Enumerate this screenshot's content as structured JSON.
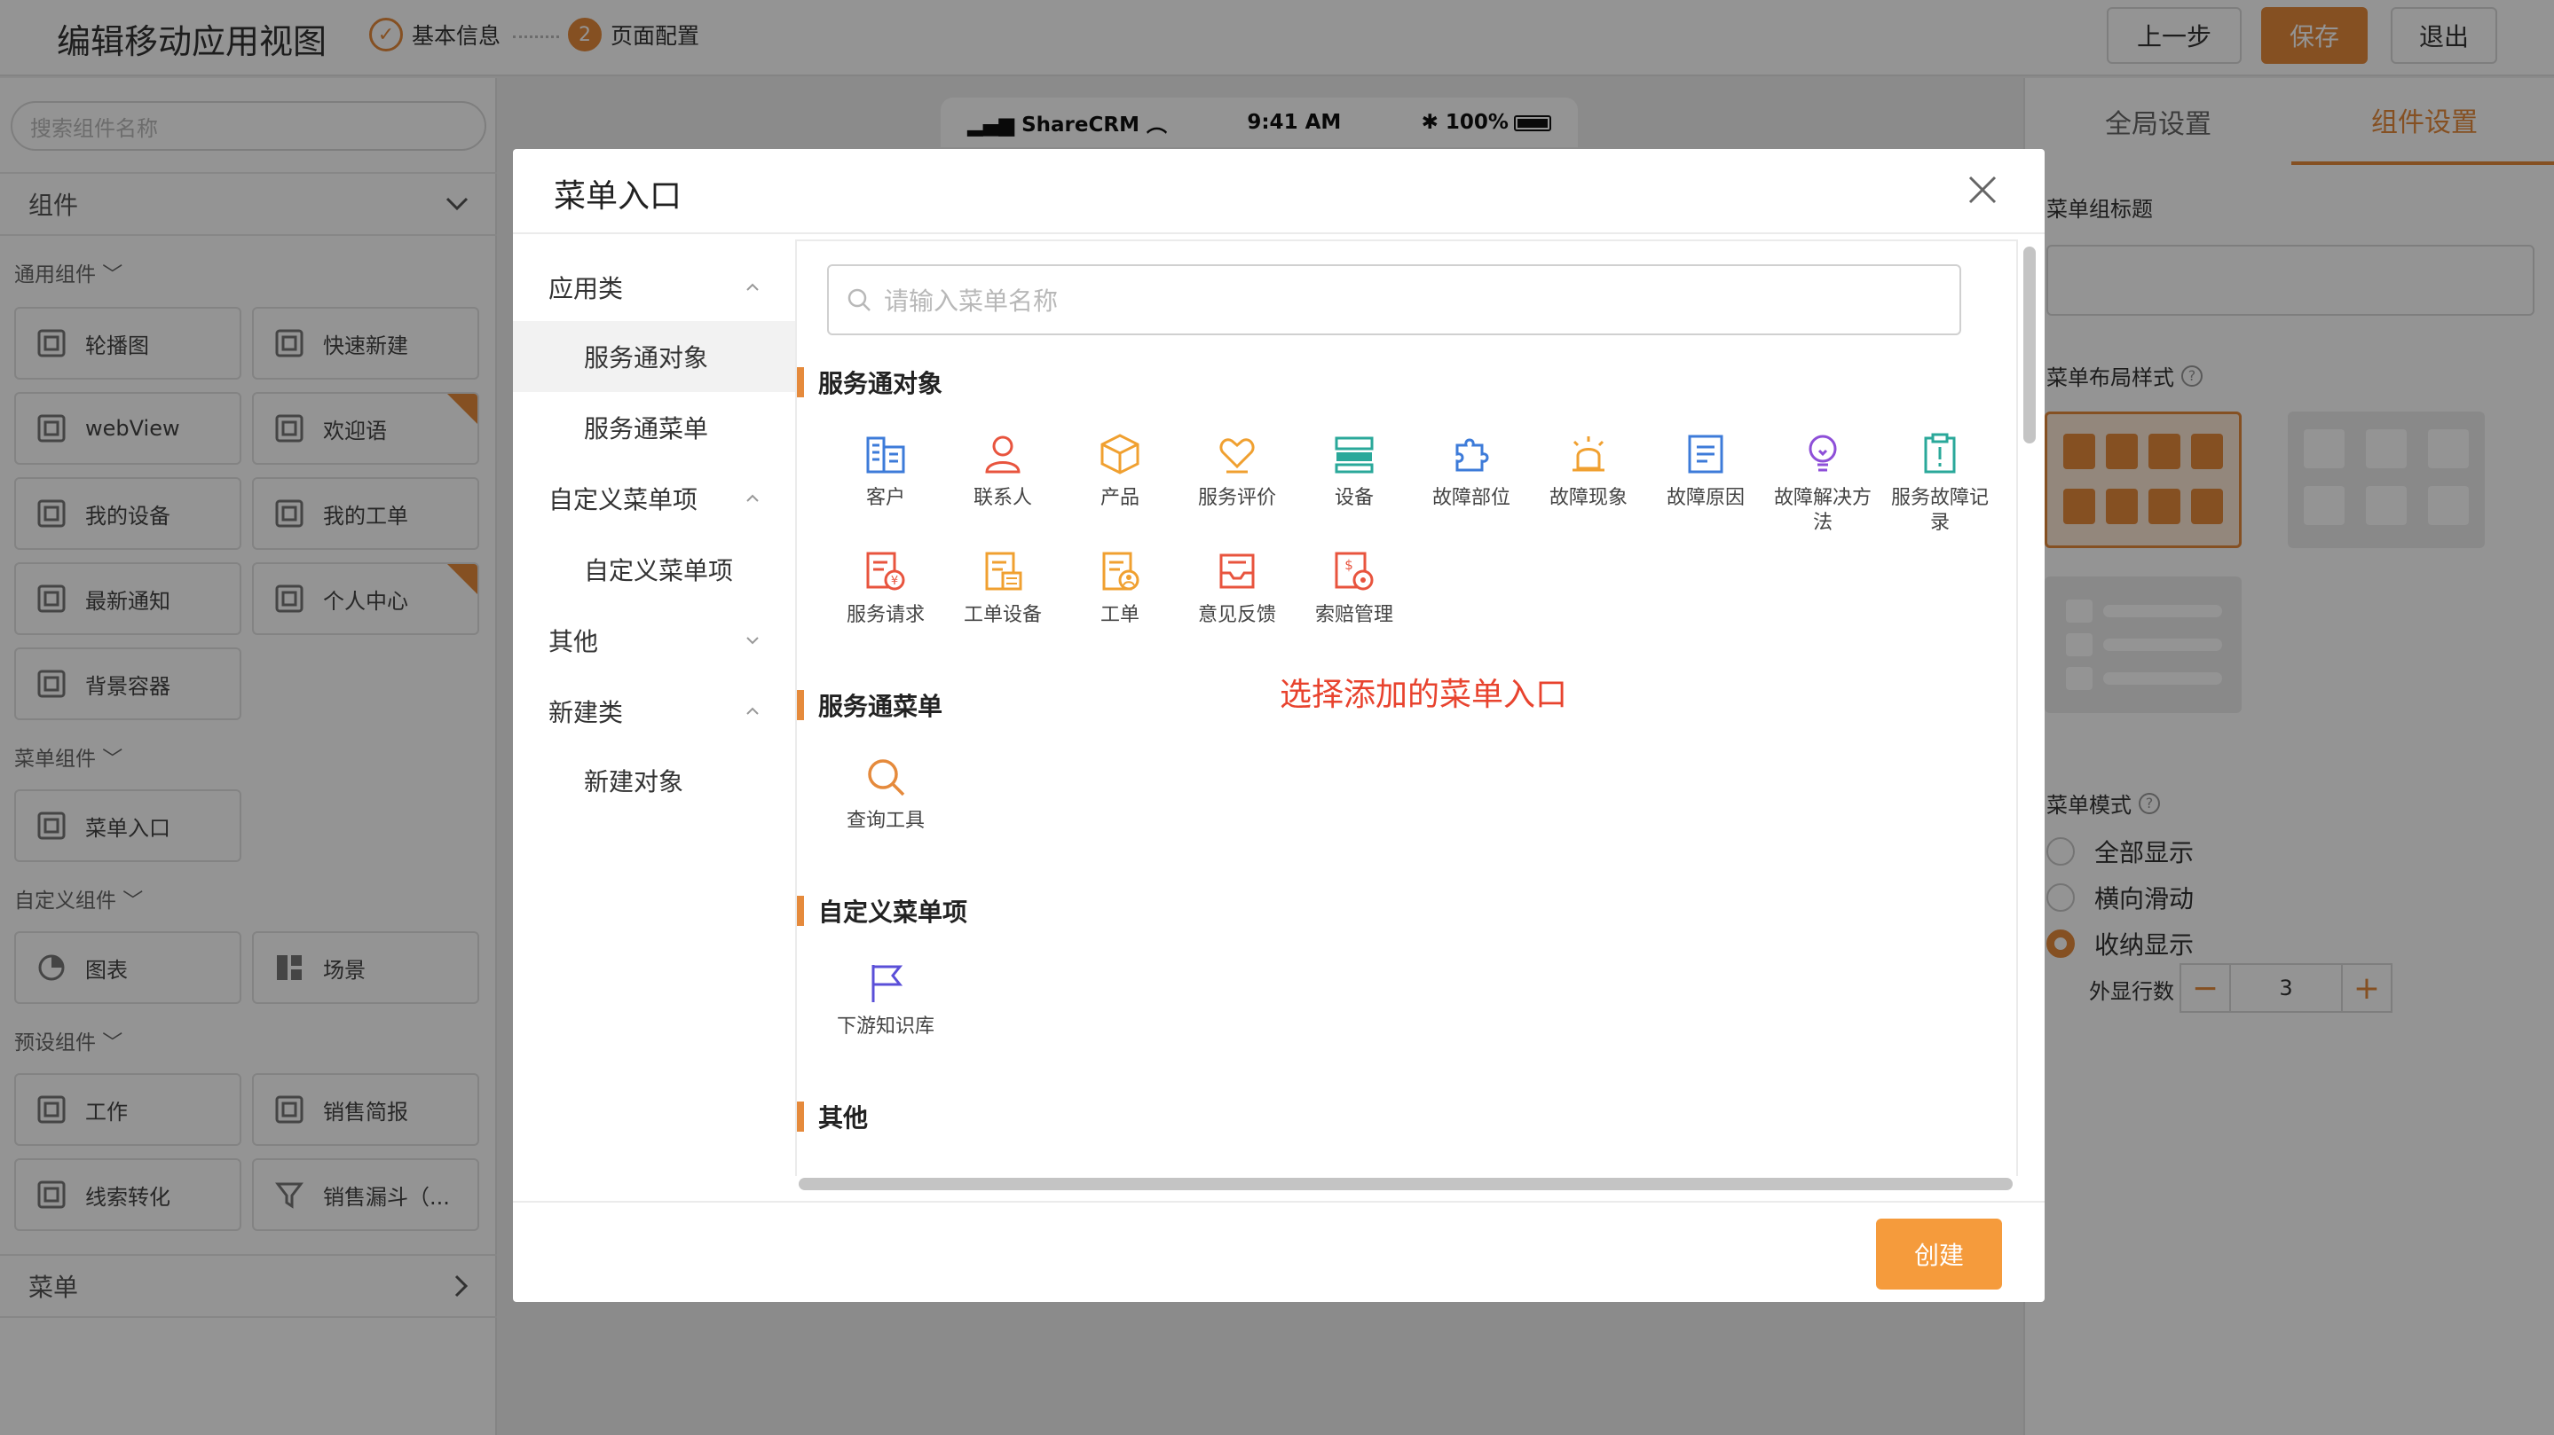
{
  "header": {
    "title": "编辑移动应用视图",
    "step1_label": "基本信息",
    "step2_number": "2",
    "step2_label": "页面配置",
    "prev_label": "上一步",
    "save_label": "保存",
    "exit_label": "退出"
  },
  "sidebar": {
    "search_placeholder": "搜索组件名称",
    "components_label": "组件",
    "groups": [
      {
        "label": "通用组件"
      },
      {
        "label": "菜单组件"
      },
      {
        "label": "自定义组件"
      },
      {
        "label": "预设组件"
      }
    ],
    "items": [
      {
        "label": "轮播图"
      },
      {
        "label": "快速新建"
      },
      {
        "label": "webView"
      },
      {
        "label": "欢迎语"
      },
      {
        "label": "我的设备"
      },
      {
        "label": "我的工单"
      },
      {
        "label": "最新通知"
      },
      {
        "label": "个人中心"
      },
      {
        "label": "背景容器"
      },
      {
        "label": "菜单入口"
      },
      {
        "label": "图表"
      },
      {
        "label": "场景"
      },
      {
        "label": "工作"
      },
      {
        "label": "销售简报"
      },
      {
        "label": "线索转化"
      },
      {
        "label": "销售漏斗（..."
      }
    ],
    "menu_label": "菜单"
  },
  "phone": {
    "carrier": "ShareCRM",
    "time": "9:41 AM",
    "battery": "100%"
  },
  "right_panel": {
    "tab_global": "全局设置",
    "tab_component": "组件设置",
    "menu_group_title_label": "菜单组标题",
    "menu_layout_label": "菜单布局样式",
    "menu_mode_label": "菜单模式",
    "modes": [
      {
        "label": "全部显示",
        "selected": false
      },
      {
        "label": "横向滑动",
        "selected": false
      },
      {
        "label": "收纳显示",
        "selected": true
      }
    ],
    "rows_label": "外显行数",
    "rows_value": "3",
    "minus": "−",
    "plus": "+"
  },
  "modal": {
    "title": "菜单入口",
    "search_placeholder": "请输入菜单名称",
    "nav": [
      {
        "label": "应用类",
        "level": 1,
        "expanded": true
      },
      {
        "label": "服务通对象",
        "level": 2,
        "active": true
      },
      {
        "label": "服务通菜单",
        "level": 2
      },
      {
        "label": "自定义菜单项",
        "level": 1,
        "expanded": true
      },
      {
        "label": "自定义菜单项",
        "level": 2
      },
      {
        "label": "其他",
        "level": 1,
        "expanded": false
      },
      {
        "label": "新建类",
        "level": 1,
        "expanded": true
      },
      {
        "label": "新建对象",
        "level": 2
      }
    ],
    "sections": [
      {
        "title": "服务通对象",
        "items": [
          {
            "label": "客户",
            "icon": "customer-icon",
            "color": "#3d7bd9"
          },
          {
            "label": "联系人",
            "icon": "contact-icon",
            "color": "#e8543e"
          },
          {
            "label": "产品",
            "icon": "product-box-icon",
            "color": "#f0a030"
          },
          {
            "label": "服务评价",
            "icon": "service-rating-icon",
            "color": "#f0a030"
          },
          {
            "label": "设备",
            "icon": "device-icon",
            "color": "#2aa89a"
          },
          {
            "label": "故障部位",
            "icon": "puzzle-icon",
            "color": "#3d7bd9"
          },
          {
            "label": "故障现象",
            "icon": "alarm-icon",
            "color": "#f0a030"
          },
          {
            "label": "故障原因",
            "icon": "document-icon",
            "color": "#3d7bd9"
          },
          {
            "label": "故障解决方法",
            "icon": "lightbulb-icon",
            "color": "#8e4fd8"
          },
          {
            "label": "服务故障记录",
            "icon": "clipboard-alert-icon",
            "color": "#2aa89a"
          },
          {
            "label": "服务请求",
            "icon": "service-request-icon",
            "color": "#e8543e"
          },
          {
            "label": "工单设备",
            "icon": "workorder-device-icon",
            "color": "#f0a030"
          },
          {
            "label": "工单",
            "icon": "workorder-icon",
            "color": "#f0a030"
          },
          {
            "label": "意见反馈",
            "icon": "feedback-inbox-icon",
            "color": "#e8543e"
          },
          {
            "label": "索赔管理",
            "icon": "claim-icon",
            "color": "#e8543e"
          }
        ]
      },
      {
        "title": "服务通菜单",
        "items": [
          {
            "label": "查询工具",
            "icon": "search-icon",
            "color": "#e58a3c"
          }
        ]
      },
      {
        "title": "自定义菜单项",
        "items": [
          {
            "label": "下游知识库",
            "icon": "flag-icon",
            "color": "#5a4fd8"
          }
        ]
      },
      {
        "title": "其他",
        "items": []
      }
    ],
    "create_label": "创建",
    "annotation": "选择添加的菜单入口"
  }
}
